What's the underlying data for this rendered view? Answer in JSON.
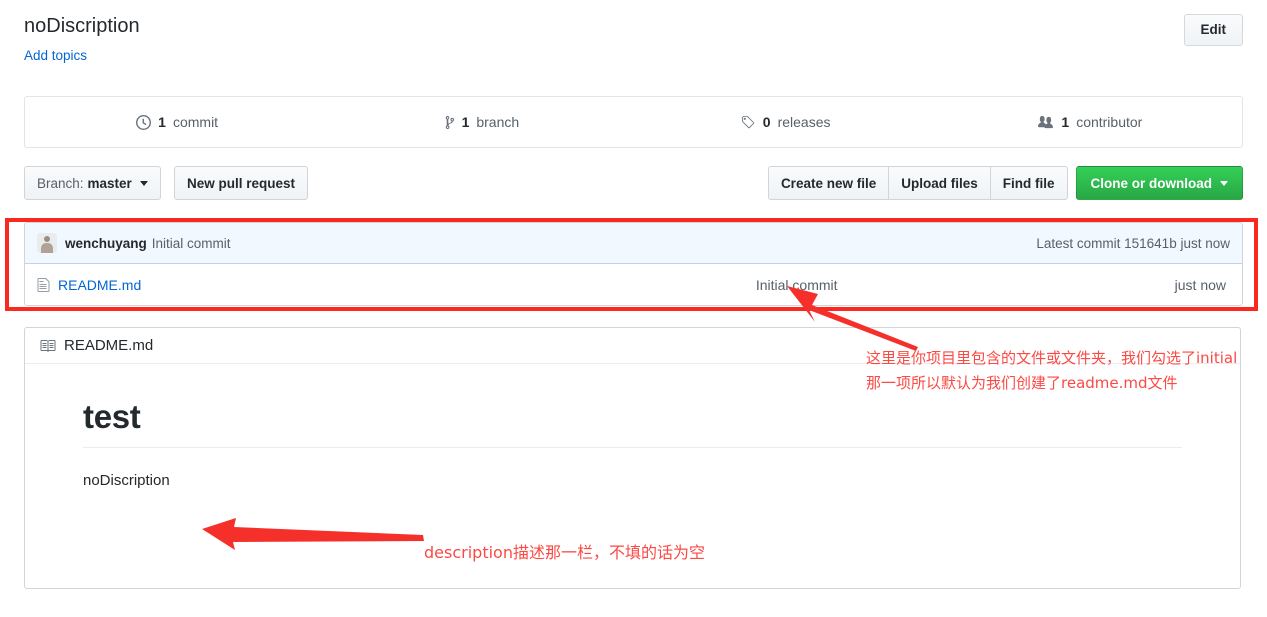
{
  "header": {
    "repo_title": "noDiscription",
    "add_topics_label": "Add topics",
    "edit_label": "Edit"
  },
  "stats": [
    {
      "icon": "history-icon",
      "count": "1",
      "label": "commit"
    },
    {
      "icon": "git-branch-icon",
      "count": "1",
      "label": "branch"
    },
    {
      "icon": "tag-icon",
      "count": "0",
      "label": "releases"
    },
    {
      "icon": "organization-icon",
      "count": "1",
      "label": "contributor"
    }
  ],
  "toolbar": {
    "branch_prefix": "Branch:",
    "branch_name": "master",
    "new_pull_request": "New pull request",
    "create_new_file": "Create new file",
    "upload_files": "Upload files",
    "find_file": "Find file",
    "clone_or_download": "Clone or download"
  },
  "commit_tease": {
    "author": "wenchuyang",
    "message": "Initial commit",
    "latest_prefix": "Latest commit",
    "sha": "151641b",
    "age": "just now"
  },
  "files": [
    {
      "icon": "file-icon",
      "name": "README.md",
      "message": "Initial commit",
      "age": "just now"
    }
  ],
  "readme": {
    "icon": "book-icon",
    "title": "README.md",
    "heading": "test",
    "paragraph": "noDiscription"
  },
  "annotations": {
    "note_1": "这里是你项目里包含的文件或文件夹，我们勾选了initial那一项所以默认为我们创建了readme.md文件",
    "note_2": "description描述那一栏，不填的话为空",
    "box_color": "#f9291f",
    "text_color": "#fb4a44"
  }
}
